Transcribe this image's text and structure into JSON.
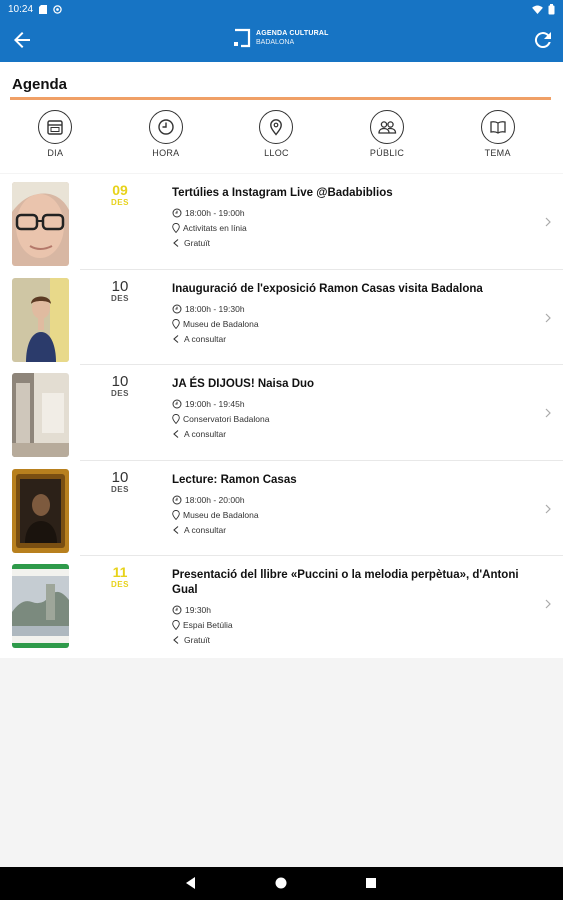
{
  "status_bar": {
    "time": "10:24"
  },
  "app_bar": {
    "brand_line1": "AGENDA CULTURAL",
    "brand_line2": "BADALONA",
    "back_icon": "arrow-left-icon",
    "refresh_icon": "refresh-icon"
  },
  "page": {
    "title": "Agenda",
    "accent_color": "#f0a066",
    "filters": [
      {
        "label": "DIA",
        "icon": "calendar-icon"
      },
      {
        "label": "HORA",
        "icon": "clock-icon"
      },
      {
        "label": "LLOC",
        "icon": "location-pin-icon"
      },
      {
        "label": "PÚBLIC",
        "icon": "people-icon"
      },
      {
        "label": "TEMA",
        "icon": "book-icon"
      }
    ]
  },
  "events": [
    {
      "day": "09",
      "month": "DES",
      "date_color": "yellow",
      "title": "Tertúlies a Instagram Live @Badabiblios",
      "time": "18:00h - 19:00h",
      "place": "Activitats en línia",
      "price": "Gratuït"
    },
    {
      "day": "10",
      "month": "DES",
      "date_color": "dark",
      "title": "Inauguració de l'exposició Ramon Casas visita Badalona",
      "time": "18:00h - 19:30h",
      "place": "Museu de Badalona",
      "price": "A consultar"
    },
    {
      "day": "10",
      "month": "DES",
      "date_color": "dark",
      "title": "JA ÉS DIJOUS! Naisa Duo",
      "time": "19:00h - 19:45h",
      "place": "Conservatori Badalona",
      "price": "A consultar"
    },
    {
      "day": "10",
      "month": "DES",
      "date_color": "dark",
      "title": "Lecture: Ramon Casas",
      "time": "18:00h - 20:00h",
      "place": "Museu de Badalona",
      "price": "A consultar"
    },
    {
      "day": "11",
      "month": "DES",
      "date_color": "yellow",
      "title": "Presentació del llibre «Puccini o la melodia perpètua», d'Antoni Gual",
      "time": "19:30h",
      "place": "Espai Betúlia",
      "price": "Gratuït"
    }
  ],
  "colors": {
    "primary": "#1774c4",
    "date_highlight": "#e7d21a"
  }
}
